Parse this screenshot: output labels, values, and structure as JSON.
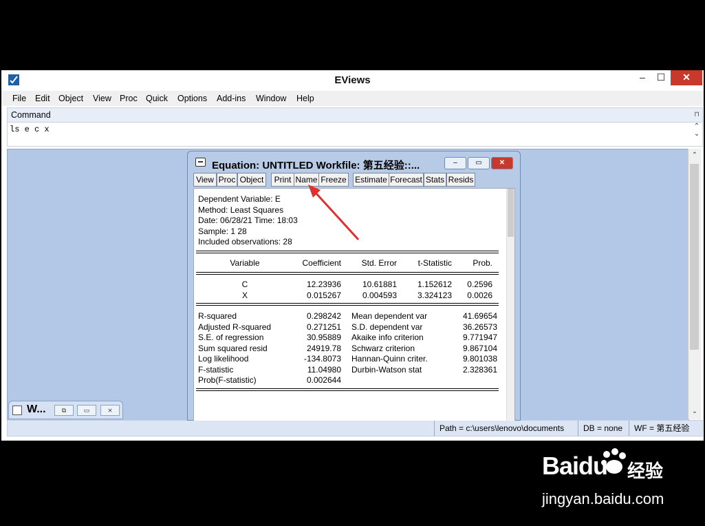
{
  "app": {
    "title": "EViews",
    "window_controls": {
      "minimize": "–",
      "maximize": "☐",
      "close": "✕"
    },
    "menu": [
      "File",
      "Edit",
      "Object",
      "View",
      "Proc",
      "Quick",
      "Options",
      "Add-ins",
      "Window",
      "Help"
    ],
    "command": {
      "label": "Command",
      "pin": "⊓",
      "text": "ls e c x",
      "scroll_up": "⌃",
      "scroll_down": "⌄"
    },
    "status": {
      "path": "Path = c:\\users\\lenovo\\documents",
      "db": "DB = none",
      "wf": "WF = 第五经验"
    },
    "minimized_window": {
      "title": "W...",
      "restore": "⧉",
      "maximize": "▭",
      "close": "⨯"
    }
  },
  "equation_window": {
    "title": "Equation: UNTITLED   Workfile: 第五经验::...",
    "controls": {
      "minimize": "–",
      "maximize": "▭",
      "close": "✕"
    },
    "toolbar": [
      "View",
      "Proc",
      "Object",
      "Print",
      "Name",
      "Freeze",
      "Estimate",
      "Forecast",
      "Stats",
      "Resids"
    ],
    "header": {
      "dependent": "Dependent Variable: E",
      "method": "Method: Least Squares",
      "date": "Date: 06/28/21   Time: 18:03",
      "sample": "Sample: 1 28",
      "obs": "Included observations: 28"
    },
    "columns": [
      "Variable",
      "Coefficient",
      "Std. Error",
      "t-Statistic",
      "Prob."
    ],
    "rows": [
      [
        "C",
        "12.23936",
        "10.61881",
        "1.152612",
        "0.2596"
      ],
      [
        "X",
        "0.015267",
        "0.004593",
        "3.324123",
        "0.0026"
      ]
    ],
    "stats_left": [
      [
        "R-squared",
        "0.298242"
      ],
      [
        "Adjusted R-squared",
        "0.271251"
      ],
      [
        "S.E. of regression",
        "30.95889"
      ],
      [
        "Sum squared resid",
        "24919.78"
      ],
      [
        "Log likelihood",
        "-134.8073"
      ],
      [
        "F-statistic",
        "11.04980"
      ],
      [
        "Prob(F-statistic)",
        "0.002644"
      ]
    ],
    "stats_right": [
      [
        "Mean dependent var",
        "41.69654"
      ],
      [
        "S.D. dependent var",
        "36.26573"
      ],
      [
        "Akaike info criterion",
        "9.771947"
      ],
      [
        "Schwarz criterion",
        "9.867104"
      ],
      [
        "Hannan-Quinn criter.",
        "9.801038"
      ],
      [
        "Durbin-Watson stat",
        "2.328361"
      ]
    ]
  },
  "watermark": {
    "brand_a": "Bai",
    "brand_b": "du",
    "cn": "经验",
    "url": "jingyan.baidu.com"
  },
  "colors": {
    "workspace": "#b3c8e6",
    "annotation_arrow": "#e03030",
    "close": "#c8392b"
  }
}
